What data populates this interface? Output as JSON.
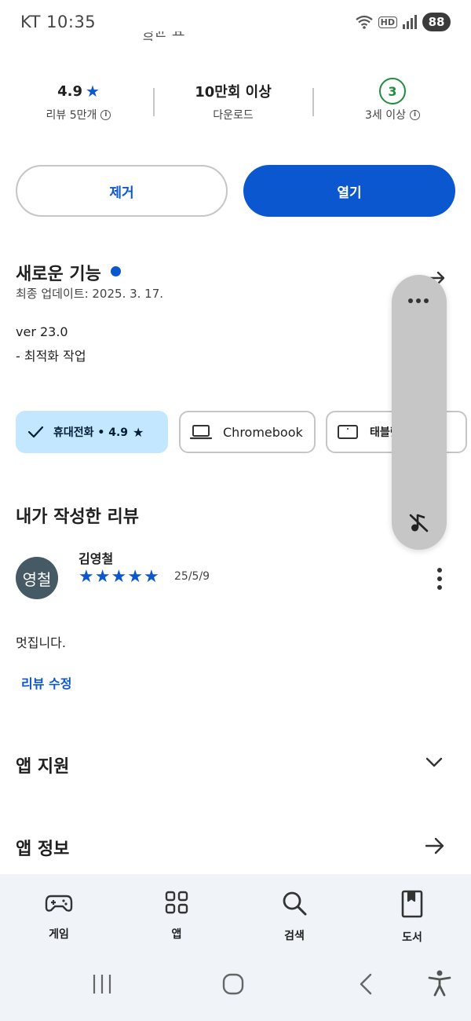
{
  "status_bar": {
    "time": "KT 10:35",
    "hd_label": "HD",
    "battery": "88"
  },
  "header": {
    "clipped_title": "평균 요금"
  },
  "stats": {
    "rating_value": "4.9",
    "rating_label": "리뷰 5만개",
    "downloads_value": "10만회 이상",
    "downloads_label": "다운로드",
    "age_badge": "3",
    "age_label": "3세 이상"
  },
  "actions": {
    "remove_label": "제거",
    "open_label": "열기"
  },
  "whats_new": {
    "title": "새로운 기능",
    "updated": "최종 업데이트: 2025. 3. 17.",
    "version": "ver 23.0",
    "notes": "- 최적화 작업"
  },
  "devices": [
    {
      "label": "휴대전화 • 4.9",
      "icon": "check-icon",
      "selected": true
    },
    {
      "label": "Chromebook",
      "icon": "laptop-icon",
      "selected": false
    },
    {
      "label": "태블릿",
      "icon": "tablet-icon",
      "selected": false
    }
  ],
  "my_review": {
    "title": "내가 작성한 리뷰",
    "avatar_text": "영철",
    "reviewer": "김영철",
    "stars": 5,
    "date": "25/5/9",
    "body": "멋집니다.",
    "edit_label": "리뷰 수정"
  },
  "sections": {
    "app_support": "앱 지원",
    "app_info": "앱 정보"
  },
  "bottom_nav": [
    {
      "label": "게임",
      "icon": "gamepad-icon"
    },
    {
      "label": "앱",
      "icon": "apps-grid-icon"
    },
    {
      "label": "검색",
      "icon": "search-icon"
    },
    {
      "label": "도서",
      "icon": "book-icon"
    }
  ],
  "colors": {
    "accent": "#0b57d0",
    "chip_selected": "#c2e7ff",
    "age_green": "#1e8e3e",
    "nav_bg": "#f0f4f9"
  }
}
